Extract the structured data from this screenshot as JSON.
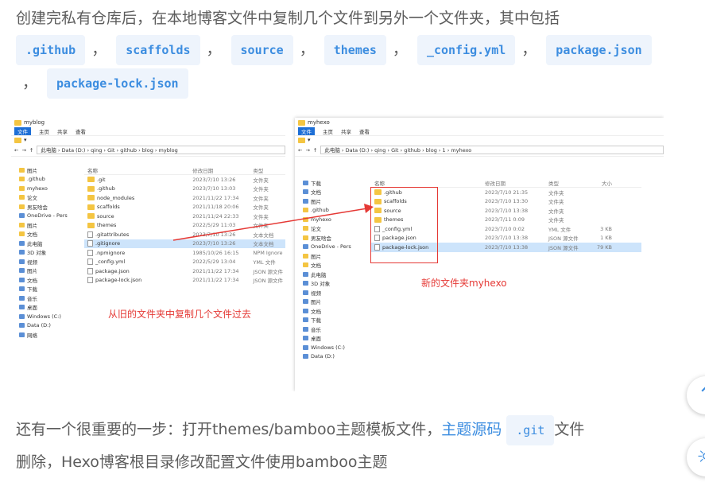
{
  "para1": {
    "text": "创建完私有仓库后，在本地博客文件中复制几个文件到另外一个文件夹，其中包括",
    "codes": [
      ".github",
      "scaffolds",
      "source",
      "themes",
      "_config.yml",
      "package.json",
      "package-lock.json"
    ],
    "sep": "，"
  },
  "para2": {
    "before": "还有一个很重要的一步：打开themes/bamboo主题模板文件，",
    "link": "主题源码",
    "code": ".git",
    "after1": "文件",
    "line2": "删除，Hexo博客根目录修改配置文件使用bamboo主题"
  },
  "screenshot": {
    "left": {
      "title": "myblog",
      "tabs": [
        "文件",
        "主页",
        "共享",
        "查看"
      ],
      "address": "此电脑 › Data (D:) › qing › Git › github › blog › myblog",
      "nav": [
        {
          "label": "图片",
          "icon": "folder"
        },
        {
          "label": ".github",
          "icon": "folder"
        },
        {
          "label": "myhexo",
          "icon": "folder"
        },
        {
          "label": "论文",
          "icon": "folder"
        },
        {
          "label": "男友啥会",
          "icon": "folder"
        },
        {
          "label": "OneDrive - Pers",
          "icon": "cloud"
        },
        {
          "label": "图片",
          "icon": "folder"
        },
        {
          "label": "文档",
          "icon": "folder"
        },
        {
          "label": "此电脑",
          "icon": "pc"
        },
        {
          "label": "3D 对象",
          "icon": "pc"
        },
        {
          "label": "视频",
          "icon": "pc"
        },
        {
          "label": "图片",
          "icon": "pc"
        },
        {
          "label": "文档",
          "icon": "pc"
        },
        {
          "label": "下载",
          "icon": "pc"
        },
        {
          "label": "音乐",
          "icon": "pc"
        },
        {
          "label": "桌面",
          "icon": "pc"
        },
        {
          "label": "Windows (C:)",
          "icon": "drive"
        },
        {
          "label": "Data (D:)",
          "icon": "drive"
        },
        {
          "label": "网络",
          "icon": "net"
        }
      ],
      "headers": [
        "名称",
        "修改日期",
        "类型"
      ],
      "files": [
        {
          "name": ".git",
          "date": "2023/7/10 13:26",
          "type": "文件夹",
          "icon": "folder"
        },
        {
          "name": ".github",
          "date": "2023/7/10 13:03",
          "type": "文件夹",
          "icon": "folder"
        },
        {
          "name": "node_modules",
          "date": "2021/11/22 17:34",
          "type": "文件夹",
          "icon": "folder"
        },
        {
          "name": "scaffolds",
          "date": "2021/11/18 20:06",
          "type": "文件夹",
          "icon": "folder"
        },
        {
          "name": "source",
          "date": "2021/11/24 22:33",
          "type": "文件夹",
          "icon": "folder"
        },
        {
          "name": "themes",
          "date": "2022/5/29 11:03",
          "type": "文件夹",
          "icon": "folder"
        },
        {
          "name": ".gitattributes",
          "date": "2023/7/10 13:26",
          "type": "文本文档",
          "icon": "doc"
        },
        {
          "name": ".gitignore",
          "date": "2023/7/10 13:26",
          "type": "文本文档",
          "icon": "doc"
        },
        {
          "name": ".npmignore",
          "date": "1985/10/26 16:15",
          "type": "NPM Ignore",
          "icon": "doc"
        },
        {
          "name": "_config.yml",
          "date": "2022/5/29 13:04",
          "type": "YML 文件",
          "icon": "doc"
        },
        {
          "name": "package.json",
          "date": "2021/11/22 17:34",
          "type": "JSON 源文件",
          "icon": "doc"
        },
        {
          "name": "package-lock.json",
          "date": "2021/11/22 17:34",
          "type": "JSON 源文件",
          "icon": "doc"
        }
      ],
      "selected_index": 7,
      "annotation": "从旧的文件夹中复制几个文件过去"
    },
    "right": {
      "title": "myhexo",
      "tabs": [
        "文件",
        "主页",
        "共享",
        "查看"
      ],
      "address": "此电脑 › Data (D:) › qing › Git › github › blog › 1 › myhexo",
      "nav": [
        {
          "label": "下载",
          "icon": "pc"
        },
        {
          "label": "文档",
          "icon": "pc"
        },
        {
          "label": "图片",
          "icon": "pc"
        },
        {
          "label": ".github",
          "icon": "folder"
        },
        {
          "label": "myhexo",
          "icon": "folder"
        },
        {
          "label": "论文",
          "icon": "folder"
        },
        {
          "label": "男友啥会",
          "icon": "folder"
        },
        {
          "label": "OneDrive - Pers",
          "icon": "cloud"
        },
        {
          "label": "图片",
          "icon": "folder"
        },
        {
          "label": "文档",
          "icon": "folder"
        },
        {
          "label": "此电脑",
          "icon": "pc"
        },
        {
          "label": "3D 对象",
          "icon": "pc"
        },
        {
          "label": "视频",
          "icon": "pc"
        },
        {
          "label": "图片",
          "icon": "pc"
        },
        {
          "label": "文档",
          "icon": "pc"
        },
        {
          "label": "下载",
          "icon": "pc"
        },
        {
          "label": "音乐",
          "icon": "pc"
        },
        {
          "label": "桌面",
          "icon": "pc"
        },
        {
          "label": "Windows (C:)",
          "icon": "drive"
        },
        {
          "label": "Data (D:)",
          "icon": "drive"
        }
      ],
      "headers": [
        "名称",
        "修改日期",
        "类型",
        "大小"
      ],
      "files": [
        {
          "name": ".github",
          "date": "2023/7/10 21:35",
          "type": "文件夹",
          "size": "",
          "icon": "folder"
        },
        {
          "name": "scaffolds",
          "date": "2023/7/10 13:30",
          "type": "文件夹",
          "size": "",
          "icon": "folder"
        },
        {
          "name": "source",
          "date": "2023/7/10 13:38",
          "type": "文件夹",
          "size": "",
          "icon": "folder"
        },
        {
          "name": "themes",
          "date": "2023/7/11 0:09",
          "type": "文件夹",
          "size": "",
          "icon": "folder"
        },
        {
          "name": "_config.yml",
          "date": "2023/7/10 0:02",
          "type": "YML 文件",
          "size": "3 KB",
          "icon": "doc"
        },
        {
          "name": "package.json",
          "date": "2023/7/10 13:38",
          "type": "JSON 源文件",
          "size": "1 KB",
          "icon": "doc"
        },
        {
          "name": "package-lock.json",
          "date": "2023/7/10 13:38",
          "type": "JSON 源文件",
          "size": "79 KB",
          "icon": "doc"
        }
      ],
      "selected_index": 6,
      "annotation": "新的文件夹myhexo"
    }
  },
  "fabs": [
    "up-icon",
    "theme-icon"
  ]
}
